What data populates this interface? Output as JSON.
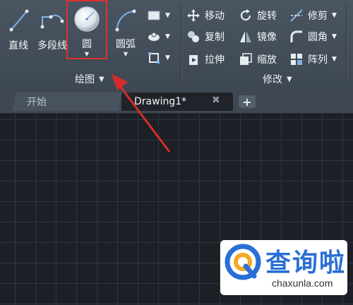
{
  "ribbon": {
    "draw_panel": {
      "title": "绘图",
      "tools": {
        "line": "直线",
        "polyline": "多段线",
        "circle": "圆",
        "arc": "圆弧"
      }
    },
    "modify_panel": {
      "title": "修改",
      "tools": {
        "move": "移动",
        "rotate": "旋转",
        "trim": "修剪",
        "copy": "复制",
        "mirror": "镜像",
        "fillet": "圆角",
        "stretch": "拉伸",
        "scale": "缩放",
        "array": "阵列"
      }
    }
  },
  "tabs": {
    "start": "开始",
    "drawing": "Drawing1*",
    "close": "✖",
    "add": "+"
  },
  "watermark": {
    "brand": "查询啦",
    "url": "chaxunla.com"
  },
  "colors": {
    "highlight": "#e03030",
    "accent_blue": "#2a6fd6"
  }
}
